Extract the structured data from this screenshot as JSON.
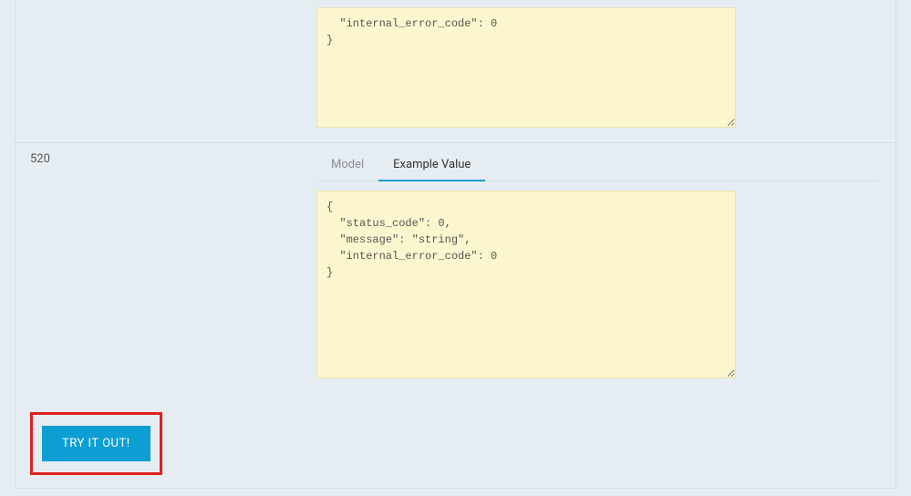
{
  "responses": {
    "top": {
      "code_fragment": "  \"internal_error_code\": 0\n}"
    },
    "r520": {
      "status": "520",
      "tabs": {
        "model": "Model",
        "example": "Example Value"
      },
      "example": "{\n  \"status_code\": 0,\n  \"message\": \"string\",\n  \"internal_error_code\": 0\n}"
    }
  },
  "try_button": "TRY IT OUT!"
}
